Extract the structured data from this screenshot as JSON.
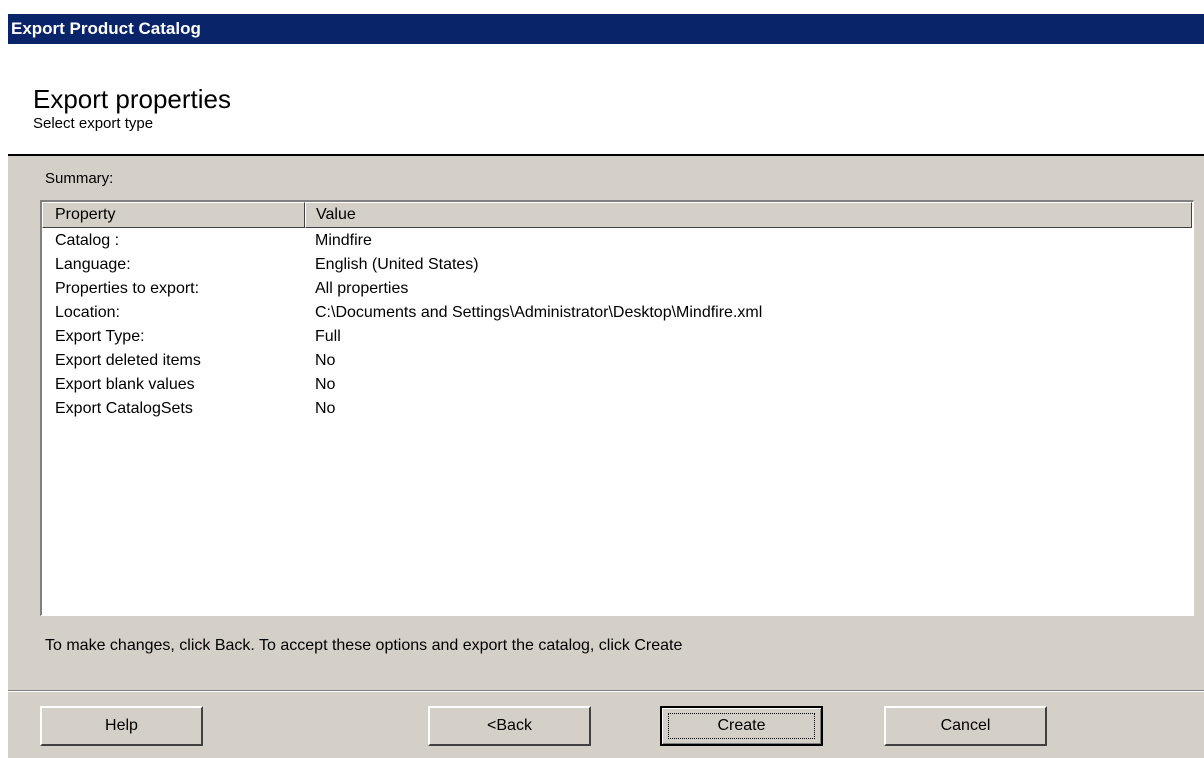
{
  "window": {
    "title": "Export Product Catalog"
  },
  "header": {
    "title": "Export properties",
    "subtitle": "Select export type"
  },
  "summary": {
    "label": "Summary:",
    "columns": [
      "Property",
      "Value"
    ],
    "rows": [
      {
        "property": "Catalog :",
        "value": "Mindfire"
      },
      {
        "property": "Language:",
        "value": "English (United States)"
      },
      {
        "property": "Properties to export:",
        "value": "All properties"
      },
      {
        "property": "Location:",
        "value": "C:\\Documents and Settings\\Administrator\\Desktop\\Mindfire.xml"
      },
      {
        "property": "Export Type:",
        "value": "Full"
      },
      {
        "property": "Export deleted items",
        "value": "No"
      },
      {
        "property": "Export blank values",
        "value": "No"
      },
      {
        "property": "Export CatalogSets",
        "value": "No"
      }
    ]
  },
  "instructions": "To make changes, click Back. To accept these options and  export the catalog, click Create",
  "buttons": {
    "help": "Help",
    "back": "<Back",
    "create": "Create",
    "cancel": "Cancel"
  }
}
